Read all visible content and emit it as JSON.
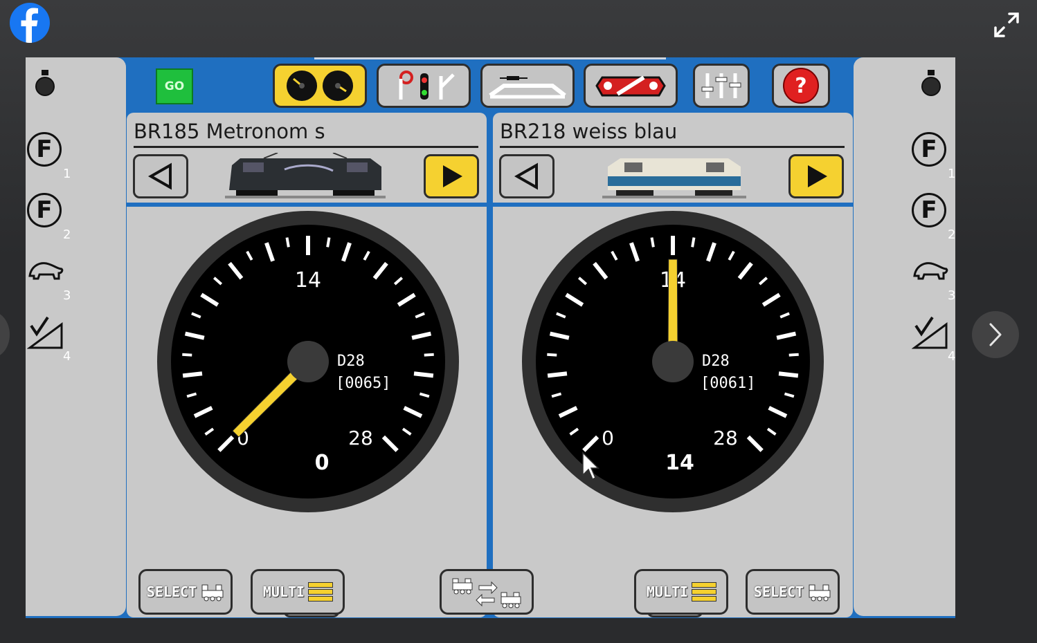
{
  "browser": {
    "logo_icon": "facebook-logo-icon",
    "expand_icon": "expand-icon",
    "next_icon": "chevron-right-icon"
  },
  "toolbar": {
    "go_label": "GO",
    "help_label": "?"
  },
  "functions": {
    "left": [
      "1",
      "2",
      "3",
      "4"
    ],
    "right": [
      "1",
      "2",
      "3",
      "4"
    ],
    "f_label": "F"
  },
  "locos": [
    {
      "name": "BR185 Metronom s",
      "speed_steps": "D28",
      "address": "[0065]",
      "label_top": "14",
      "label_left": "0",
      "label_right": "28",
      "label_bottom": "0",
      "needle_fraction": 0.0,
      "colors": {
        "needle": "#f5d130"
      }
    },
    {
      "name": "BR218 weiss blau",
      "speed_steps": "D28",
      "address": "[0061]",
      "label_top": "14",
      "label_left": "0",
      "label_right": "28",
      "label_bottom": "14",
      "needle_fraction": 0.5,
      "colors": {
        "needle": "#f5d130"
      }
    }
  ],
  "bottom": {
    "select_left": "SELECT",
    "multi_left": "MULTI",
    "multi_right": "MULTI",
    "select_right": "SELECT"
  },
  "colors": {
    "app_blue": "#1f6fc0",
    "panel_gray": "#c9c9c9",
    "accent_yellow": "#f5d130",
    "go_green": "#1fbf3d",
    "help_red": "#e02020"
  }
}
